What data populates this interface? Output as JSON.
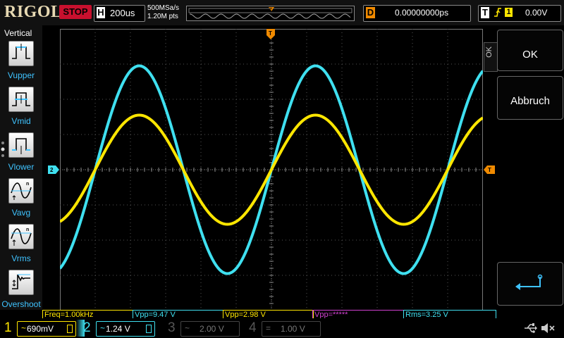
{
  "header": {
    "brand": "RIGOL",
    "run_state": "STOP",
    "horizontal": {
      "label": "H",
      "timebase": "200us"
    },
    "acquisition": {
      "sample_rate": "500MSa/s",
      "memory_depth": "1.20M pts"
    },
    "delay": {
      "label": "D",
      "value": "0.00000000ps"
    },
    "trigger": {
      "label": "T",
      "source": "1",
      "level": "0.00V",
      "edge_icon": "rising-edge-icon"
    }
  },
  "left_menu": {
    "title": "Vertical",
    "items": [
      {
        "label": "Vupper",
        "icon": "vupper-icon"
      },
      {
        "label": "Vmid",
        "icon": "vmid-icon"
      },
      {
        "label": "Vlower",
        "icon": "vlower-icon"
      },
      {
        "label": "Vavg",
        "icon": "vavg-icon"
      },
      {
        "label": "Vrms",
        "icon": "vrms-icon"
      },
      {
        "label": "Overshoot",
        "icon": "overshoot-icon"
      }
    ]
  },
  "right_menu": {
    "close_label": "OK",
    "ok_label": "OK",
    "cancel_label": "Abbruch",
    "enter_icon": "enter-icon"
  },
  "markers": {
    "trigger_pos": "T",
    "trigger_level": "T",
    "ch2_ground": "2"
  },
  "measurements": [
    {
      "text": "Freq=1.00kHz",
      "color": "#ffe600"
    },
    {
      "text": "Vpp=9.47 V",
      "color": "#3fe0f0"
    },
    {
      "text": "Vpp=2.98 V",
      "color": "#ffe600"
    },
    {
      "text": "Vpp=*****",
      "color": "#d040d0"
    },
    {
      "text": "Rms=3.25 V",
      "color": "#3fe0f0"
    }
  ],
  "channels": [
    {
      "num": "1",
      "coupling": "~",
      "scale": "690mV",
      "color": "#ffe600",
      "active": true
    },
    {
      "num": "2",
      "coupling": "~",
      "scale": "1.24 V",
      "color": "#3fe0f0",
      "active": true
    },
    {
      "num": "3",
      "coupling": "~",
      "scale": "2.00 V",
      "color": "#d040d0",
      "active": false
    },
    {
      "num": "4",
      "coupling": "=",
      "scale": "1.00 V",
      "color": "#5080ff",
      "active": false
    }
  ],
  "colors": {
    "ch1": "#ffe600",
    "ch2": "#3fe0f0",
    "grid": "#555555",
    "trigger": "#f08a00"
  },
  "waveform": {
    "frequency_khz": 1.0,
    "timebase_us_per_div": 200,
    "ch1_amplitude_div": 1.55,
    "ch2_amplitude_div": 2.95,
    "ch1_phase_note": "in phase with ch2"
  }
}
